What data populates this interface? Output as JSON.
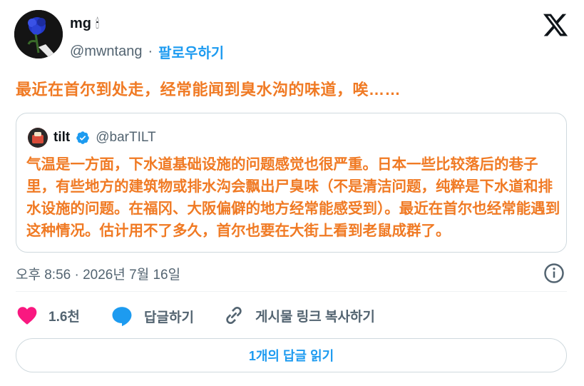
{
  "author": {
    "display_name": "mg",
    "emoji": "🕯",
    "handle": "@mwntang",
    "separator": "·",
    "follow_label": "팔로우하기"
  },
  "tweet": {
    "text": "最近在首尔到处走，经常能闻到臭水沟的味道，唉……"
  },
  "quote": {
    "name": "tilt",
    "handle": "@barTILT",
    "body": "气温是一方面，下水道基础设施的问题感觉也很严重。日本一些比较落后的巷子里，有些地方的建筑物或排水沟会飘出尸臭味（不是清洁问题，纯粹是下水道和排水设施的问题。在福冈、大阪偏僻的地方经常能感受到）。最近在首尔也经常能遇到这种情况。估计用不了多久，首尔也要在大街上看到老鼠成群了。"
  },
  "meta": {
    "timestamp": "오후 8:56 · 2026년 7월 16일"
  },
  "actions": {
    "like_count": "1.6천",
    "reply_label": "답글하기",
    "copy_link_label": "게시물 링크 복사하기"
  },
  "read_replies_label": "1개의 답글 읽기",
  "colors": {
    "accent": "#1d9bf0",
    "like": "#f91880",
    "overlay_text": "#f07a24"
  }
}
